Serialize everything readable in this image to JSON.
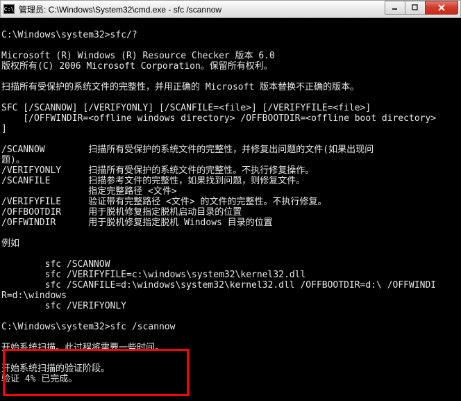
{
  "titlebar": {
    "icon_glyph": "C:\\",
    "title": "管理员: C:\\Windows\\System32\\cmd.exe - sfc  /scannow"
  },
  "controls": {
    "minimize_title": "Minimize",
    "maximize_title": "Maximize",
    "close_title": "Close"
  },
  "terminal": {
    "prompt1": "C:\\Windows\\system32>sfc/?",
    "line2": "Microsoft (R) Windows (R) Resource Checker 版本 6.0",
    "line3": "版权所有(C) 2006 Microsoft Corporation。保留所有权利。",
    "line4": "扫描所有受保护的系统文件的完整性，并用正确的 Microsoft 版本替换不正确的版本。",
    "line5": "SFC [/SCANNOW] [/VERIFYONLY] [/SCANFILE=<file>] [/VERIFYFILE=<file>]",
    "line6": "    [/OFFWINDIR=<offline windows directory> /OFFBOOTDIR=<offline boot directory>",
    "line6b": "]",
    "opt_scannow_k": "/SCANNOW",
    "opt_scannow_v1": "扫描所有受保护的系统文件的完整性，并修复出问题的文件(如果出现问",
    "opt_scannow_v2": "题)。",
    "opt_verifyonly_k": "/VERIFYONLY",
    "opt_verifyonly_v": "扫描所有受保护的系统文件的完整性。不执行修复操作。",
    "opt_scanfile_k": "/SCANFILE",
    "opt_scanfile_v1": "扫描参考文件的完整性，如果找到问题，则修复文件。",
    "opt_scanfile_v2": "指定完整路径 <文件>",
    "opt_verifyfile_k": "/VERIFYFILE",
    "opt_verifyfile_v": "验证带有完整路径 <文件> 的文件的完整性。不执行修复。",
    "opt_offbootdir_k": "/OFFBOOTDIR",
    "opt_offbootdir_v": "用于脱机修复指定脱机启动目录的位置",
    "opt_offwindir_k": "/OFFWINDIR",
    "opt_offwindir_v": "用于脱机修复指定脱机 Windows 目录的位置",
    "ex_label": "例如",
    "ex1": "        sfc /SCANNOW",
    "ex2": "        sfc /VERIFYFILE=c:\\windows\\system32\\kernel32.dll",
    "ex3": "        sfc /SCANFILE=d:\\windows\\system32\\kernel32.dll /OFFBOOTDIR=d:\\ /OFFWINDI",
    "ex3b": "R=d:\\windows",
    "ex4": "        sfc /VERIFYONLY",
    "prompt2": "C:\\Windows\\system32>sfc /scannow",
    "scan1": "开始系统扫描。此过程将需要一些时间。",
    "scan2": "开始系统扫描的验证阶段。",
    "scan3": "验证 4% 已完成。"
  },
  "highlight": {
    "semantic": "scan-progress-highlight"
  }
}
